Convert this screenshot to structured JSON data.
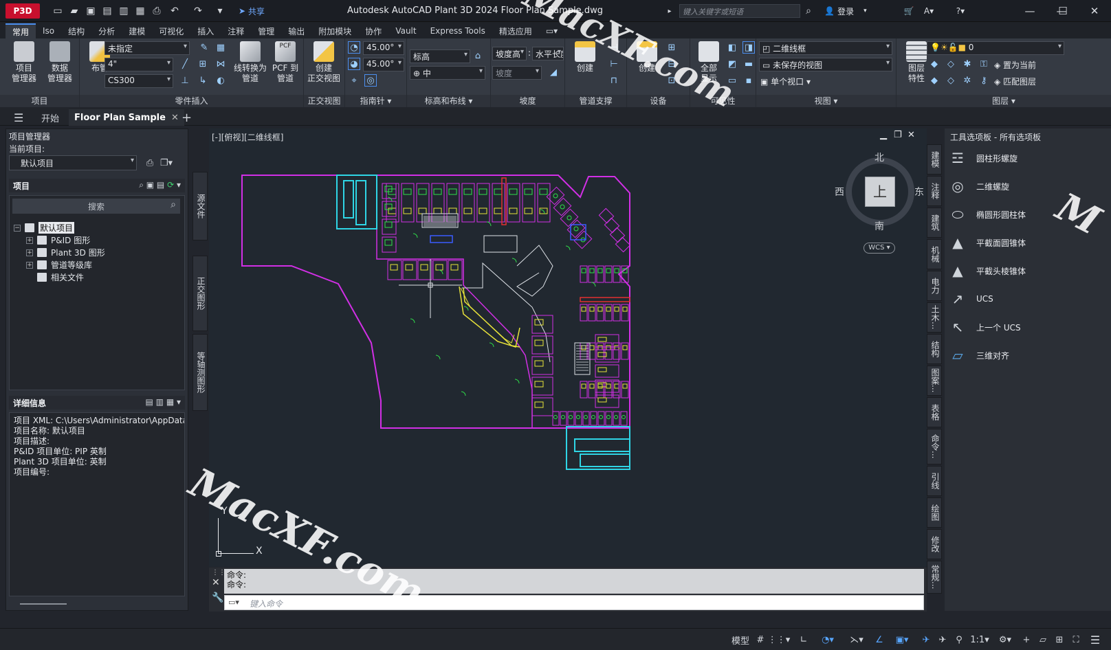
{
  "titlebar": {
    "logo": "P3D",
    "share": "共享",
    "title": "Autodesk AutoCAD Plant 3D 2024    Floor Plan Sample.dwg",
    "search_placeholder": "键入关键字或短语",
    "login": "登录"
  },
  "ribbon_tabs": [
    "常用",
    "Iso",
    "结构",
    "分析",
    "建模",
    "可视化",
    "插入",
    "注释",
    "管理",
    "输出",
    "附加模块",
    "协作",
    "Vault",
    "Express Tools",
    "精选应用"
  ],
  "ribbon": {
    "project": {
      "title": "项目",
      "btn1": "项目\n管理器",
      "btn2": "数据\n管理器"
    },
    "parts": {
      "title": "零件插入",
      "btn1": "布管",
      "dd1": "未指定",
      "dd2": "4\"",
      "dd3": "CS300",
      "btn2": "线转换为\n管道",
      "btn3": "PCF 到\n管道",
      "pcf_label": "PCF"
    },
    "ortho": {
      "title": "正交视图",
      "btn1": "创建\n正交视图"
    },
    "compass": {
      "title": "指南针",
      "angle1": "45.00°",
      "angle2": "45.00°"
    },
    "elevation": {
      "title": "标高和布线",
      "dd1": "标高",
      "dd2": "中"
    },
    "slope": {
      "title": "坡度",
      "l1": "坡度高",
      "l2": "水平长度",
      "l3": "坡度"
    },
    "support": {
      "title": "管道支撑",
      "btn1": "创建"
    },
    "equipment": {
      "title": "设备",
      "btn1": "创建"
    },
    "visibility": {
      "title": "可见性",
      "btn1": "全部\n显示"
    },
    "view": {
      "title": "视图",
      "dd1": "二维线框",
      "dd2": "未保存的视图",
      "l3": "单个视口"
    },
    "layers": {
      "title": "图层",
      "btn1": "图层\n特性",
      "dd1": "0",
      "l1": "置为当前",
      "l2": "匹配图层"
    }
  },
  "file_tabs": {
    "start": "开始",
    "active": "Floor Plan Sample"
  },
  "left_panel": {
    "title": "项目管理器",
    "current_label": "当前项目:",
    "current_value": "默认项目",
    "section_project": "项目",
    "search": "搜索",
    "tree": [
      "默认项目",
      "P&ID 图形",
      "Plant 3D 图形",
      "管道等级库",
      "相关文件"
    ],
    "section_details": "详细信息",
    "details": [
      "项目 XML: C:\\Users\\Administrator\\AppData",
      "项目名称: 默认项目",
      "项目描述:",
      "P&ID 项目单位: PIP 英制",
      "Plant 3D 项目单位: 英制",
      "项目编号:"
    ]
  },
  "left_vtabs": [
    "源文件",
    "正交图形",
    "等轴测图形"
  ],
  "canvas": {
    "view_label": "[-][俯视][二维线框]",
    "viewcube": {
      "n": "北",
      "s": "南",
      "e": "东",
      "w": "西",
      "top": "上",
      "wcs": "WCS"
    },
    "ucs_x": "X",
    "ucs_y": "Y"
  },
  "command": {
    "h1": "命令:",
    "h2": "命令:",
    "placeholder": "键入命令"
  },
  "right_vtabs": [
    "建模",
    "注释",
    "建筑",
    "机械",
    "电力",
    "土木...",
    "结构",
    "图案...",
    "表格",
    "命令...",
    "引线",
    "绘图",
    "修改",
    "常规..."
  ],
  "palette": {
    "title": "工具选项板 - 所有选项板",
    "items": [
      "圆柱形螺旋",
      "二维螺旋",
      "椭圆形圆柱体",
      "平截面圆锥体",
      "平截头棱锥体",
      "UCS",
      "上一个 UCS",
      "三维对齐"
    ]
  },
  "statusbar": {
    "model": "模型",
    "scale": "1:1"
  },
  "watermarks": [
    "MacXF.com",
    "MacXF.com",
    "M"
  ],
  "colors": {
    "accent": "#4b8ff0",
    "canvas_bg": "#212830",
    "magenta": "#d22fe6",
    "cyan": "#2fd6e6",
    "yellow": "#e8e33a",
    "green": "#2fe04a",
    "red": "#e23030",
    "white": "#dfe3e8"
  }
}
